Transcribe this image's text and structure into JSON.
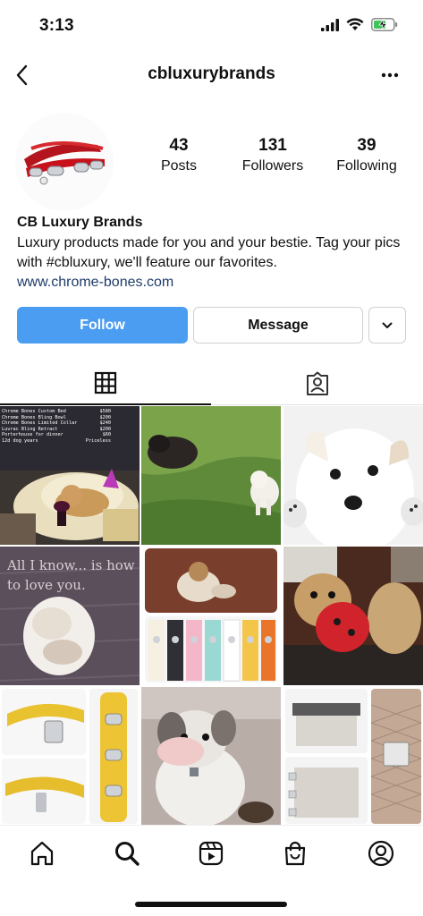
{
  "status": {
    "time": "3:13"
  },
  "header": {
    "username": "cbluxurybrands"
  },
  "profile": {
    "posts": {
      "count": "43",
      "label": "Posts"
    },
    "followers": {
      "count": "131",
      "label": "Followers"
    },
    "following": {
      "count": "39",
      "label": "Following"
    },
    "name": "CB Luxury Brands",
    "bio": "Luxury products made for you and your bestie. Tag your pics with #cbluxury, we'll feature our favorites.",
    "link": "www.chrome-bones.com"
  },
  "actions": {
    "follow_label": "Follow",
    "message_label": "Message"
  },
  "grid_posts": {
    "post1": {
      "rows": [
        [
          "Chrome Bones Custom Bed",
          "$580"
        ],
        [
          "Chrome Bones Bling Bowl",
          "$200"
        ],
        [
          "Chrome Bones Limited Collar",
          "$240"
        ],
        [
          "Luvrac Bling Retract",
          "$200"
        ],
        [
          "Porterhouse for dinner",
          "$60"
        ],
        [
          "12d dog years",
          "Priceless"
        ]
      ]
    },
    "post4": {
      "line1": "All I know... is how",
      "line2": "to love you."
    }
  },
  "colors": {
    "follow_button": "#4a9df0",
    "link": "#1f3c6a"
  },
  "icons": {
    "back": "chevron-left-icon",
    "more": "more-dots-icon",
    "grid": "grid-icon",
    "tagged": "tagged-person-icon",
    "home": "home-icon",
    "search": "search-icon",
    "reels": "reels-icon",
    "shop": "shop-bag-icon",
    "profile": "profile-icon"
  }
}
